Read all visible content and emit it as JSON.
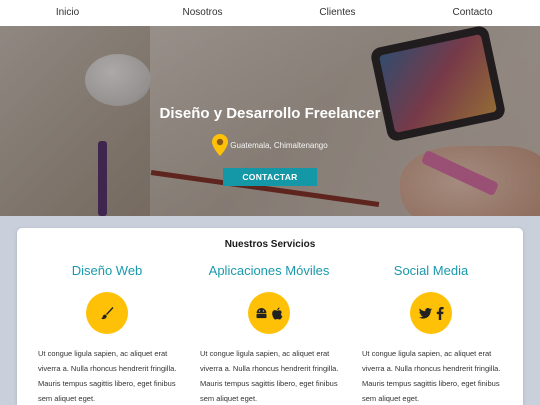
{
  "nav": {
    "items": [
      "Inicio",
      "Nosotros",
      "Clientes",
      "Contacto"
    ]
  },
  "hero": {
    "title": "Diseño y Desarrollo Freelancer",
    "location": "Guatemala, Chimaltenango",
    "location_icon": "map-pin-icon",
    "cta_label": "CONTACTAR"
  },
  "services": {
    "title": "Nuestros Servicios",
    "items": [
      {
        "title": "Diseño Web",
        "icons": [
          "paintbrush-icon"
        ],
        "text": "Ut congue ligula sapien, ac aliquet erat viverra a. Nulla rhoncus hendrerit fringilla. Mauris tempus sagittis libero, eget finibus sem aliquet eget."
      },
      {
        "title": "Aplicaciones Móviles",
        "icons": [
          "android-icon",
          "apple-icon"
        ],
        "text": "Ut congue ligula sapien, ac aliquet erat viverra a. Nulla rhoncus hendrerit fringilla. Mauris tempus sagittis libero, eget finibus sem aliquet eget."
      },
      {
        "title": "Social Media",
        "icons": [
          "twitter-icon",
          "facebook-icon"
        ],
        "text": "Ut congue ligula sapien, ac aliquet erat viverra a. Nulla rhoncus hendrerit fringilla. Mauris tempus sagittis libero, eget finibus sem aliquet eget."
      }
    ]
  },
  "colors": {
    "accent": "#1a99ad",
    "cta": "#1497a7",
    "icon_circle": "#ffc107",
    "pin": "#ffc107"
  }
}
